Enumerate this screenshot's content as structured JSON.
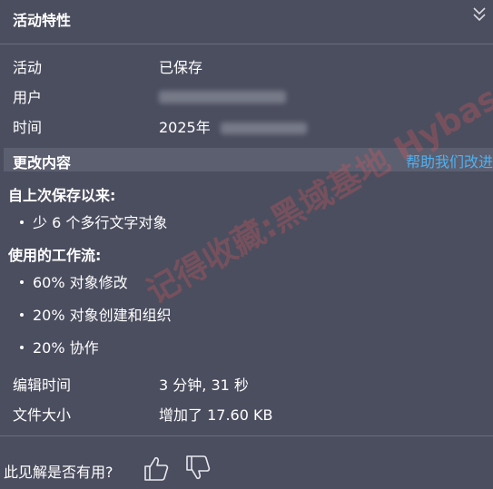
{
  "panel": {
    "title": "活动特性"
  },
  "properties": {
    "activity": {
      "label": "活动",
      "value": "已保存"
    },
    "user": {
      "label": "用户"
    },
    "time": {
      "label": "时间",
      "value_prefix": "2025年"
    }
  },
  "changes": {
    "title": "更改内容",
    "help_link": "帮助我们改进",
    "since_last_save": {
      "heading": "自上次保存以来:",
      "items": [
        "少 6 个多行文字对象"
      ]
    },
    "workflows": {
      "heading": "使用的工作流:",
      "items": [
        "60% 对象修改",
        "20% 对象创建和组织",
        "20% 协作"
      ]
    }
  },
  "stats": {
    "edit_time": {
      "label": "编辑时间",
      "value": "3 分钟, 31 秒"
    },
    "file_size": {
      "label": "文件大小",
      "value": "增加了 17.60 KB"
    }
  },
  "feedback": {
    "question": "此见解是否有用?"
  },
  "watermark": {
    "text": "记得收藏:黑域基地 Hybase.com"
  },
  "colors": {
    "background": "#4b4e5f",
    "section_bar": "#5c5f70",
    "link": "#4fb0f0",
    "text": "#ffffff"
  },
  "icons": {
    "collapse": "chevrons-down-icon",
    "thumbs_up": "thumbs-up-icon",
    "thumbs_down": "thumbs-down-icon"
  }
}
